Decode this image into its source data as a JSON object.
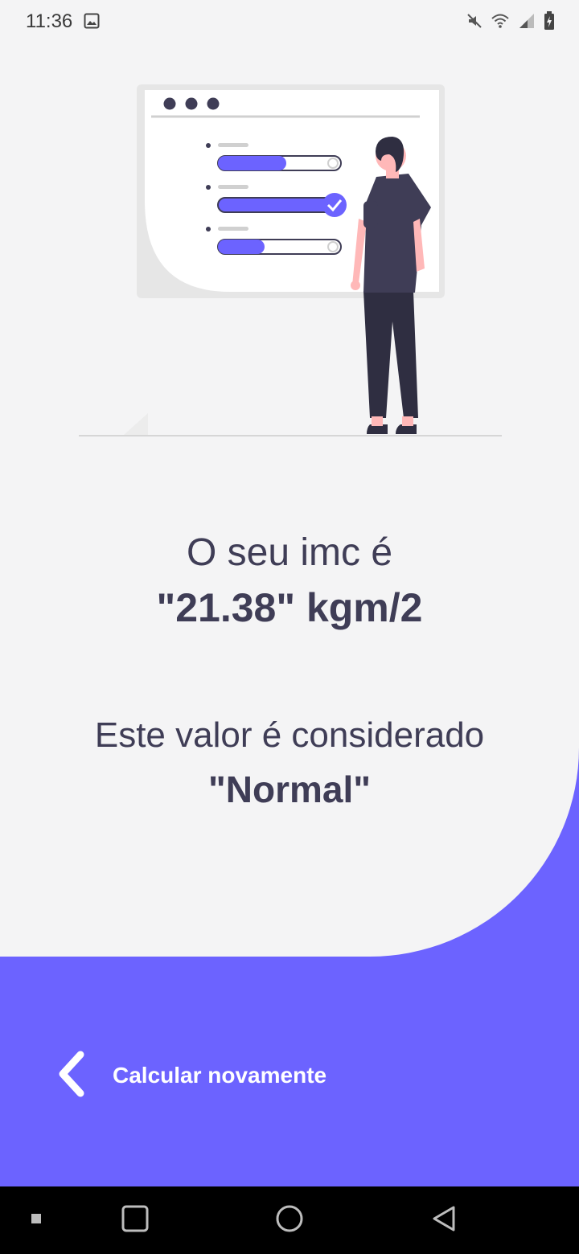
{
  "status_bar": {
    "time": "11:36",
    "icons": [
      "gallery-icon",
      "mute-icon",
      "wifi-icon",
      "signal-icon",
      "battery-icon"
    ]
  },
  "illustration": {
    "name": "person-viewing-progress-checklist",
    "progress_bars": [
      0.6,
      1.0,
      0.38
    ],
    "colors": {
      "accent": "#6c63ff",
      "dark": "#3f3d56",
      "skin": "#ffb8b8",
      "panel": "#e6e6e6"
    }
  },
  "result": {
    "line1": "O seu imc é",
    "line2": "\"21.38\" kgm/2"
  },
  "classification": {
    "line1": "Este valor é considerado",
    "line2": "\"Normal\""
  },
  "actions": {
    "recalculate_label": "Calcular novamente"
  },
  "colors": {
    "background": "#f4f4f5",
    "accent": "#6c63ff",
    "text": "#3f3d56"
  },
  "nav_bar": {
    "items": [
      "recent-apps-icon",
      "home-icon",
      "back-icon"
    ]
  }
}
